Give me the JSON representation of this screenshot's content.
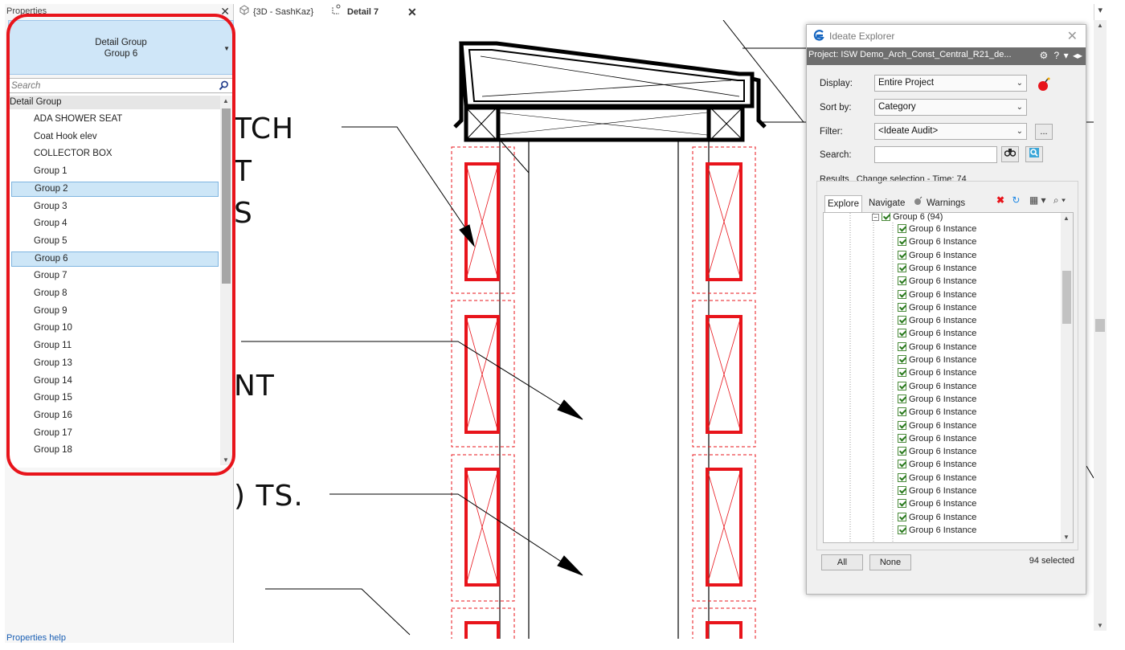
{
  "properties": {
    "title": "Properties",
    "type_selector": {
      "family": "Detail Group",
      "type": "Group 6"
    },
    "search_placeholder": "Search",
    "list_header": "Detail Group",
    "items": [
      "ADA SHOWER SEAT",
      "Coat Hook elev",
      "COLLECTOR BOX",
      "Group 1",
      "Group 2",
      "Group 3",
      "Group 4",
      "Group 5",
      "Group 6",
      "Group 7",
      "Group 8",
      "Group 9",
      "Group 10",
      "Group 11",
      "Group 13",
      "Group 14",
      "Group 15",
      "Group 16",
      "Group 17",
      "Group 18"
    ],
    "selected_items": [
      "Group 2",
      "Group 6"
    ],
    "help_link": "Properties help",
    "highlight_color": "#e8141b"
  },
  "view_tabs": [
    {
      "label": "{3D - SashKaz}",
      "active": false
    },
    {
      "label": "Detail 7",
      "active": true
    }
  ],
  "drawing_text": [
    "TCH",
    "T",
    "S",
    "NT",
    ") TS."
  ],
  "ideate": {
    "title": "Ideate Explorer",
    "project": "Project: ISW Demo_Arch_Const_Central_R21_de...",
    "display_label": "Display:",
    "display_value": "Entire Project",
    "sort_label": "Sort by:",
    "sort_value": "Category",
    "filter_label": "Filter:",
    "filter_value": "<Ideate Audit>",
    "filter_more": "...",
    "search_label": "Search:",
    "search_value": "",
    "results_label": "Results",
    "results_status": "Change selection - Time: 74",
    "tabs": [
      "Explore",
      "Navigate",
      "Warnings"
    ],
    "tree_parent": "Group 6 (94)",
    "tree_child": "Group 6 Instance",
    "tree_child_visible_count": 24,
    "btn_all": "All",
    "btn_none": "None",
    "selected_count": "94 selected"
  },
  "colors": {
    "accent_red": "#e8141b",
    "selection_blue": "#cde6f7",
    "project_bar": "#6e6e6e"
  }
}
